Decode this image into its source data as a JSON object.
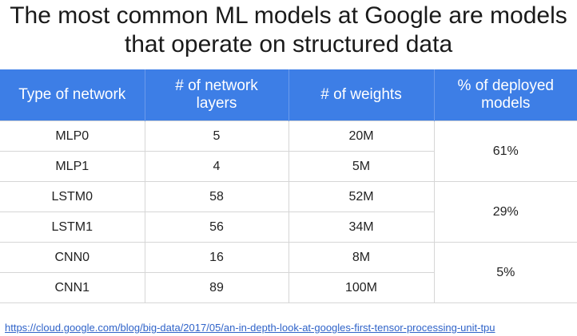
{
  "title": {
    "line1": "The most common ML models at Google are models",
    "line2": "that operate on structured data"
  },
  "table": {
    "headers": [
      {
        "lines": [
          "Type of network"
        ]
      },
      {
        "lines": [
          "# of network",
          "layers"
        ]
      },
      {
        "lines": [
          "# of weights"
        ]
      },
      {
        "lines": [
          "% of deployed",
          "models"
        ]
      }
    ],
    "rows": [
      {
        "network": "MLP0",
        "layers": "5",
        "weights": "20M"
      },
      {
        "network": "MLP1",
        "layers": "4",
        "weights": "5M"
      },
      {
        "network": "LSTM0",
        "layers": "58",
        "weights": "52M"
      },
      {
        "network": "LSTM1",
        "layers": "56",
        "weights": "34M"
      },
      {
        "network": "CNN0",
        "layers": "16",
        "weights": "8M"
      },
      {
        "network": "CNN1",
        "layers": "89",
        "weights": "100M"
      }
    ],
    "deployed_groups": [
      "61%",
      "29%",
      "5%"
    ]
  },
  "source_link": "https://cloud.google.com/blog/big-data/2017/05/an-in-depth-look-at-googles-first-tensor-processing-unit-tpu"
}
